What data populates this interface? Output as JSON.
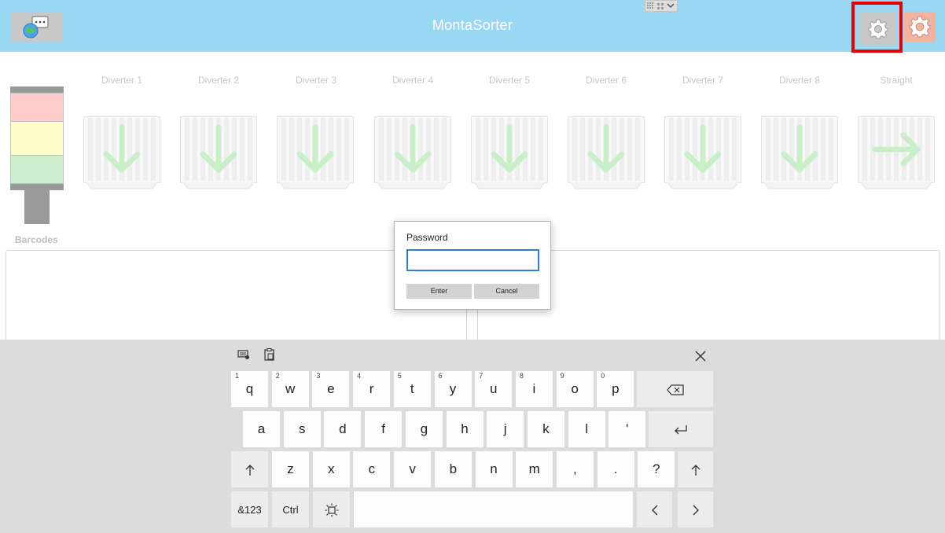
{
  "header": {
    "title": "MontaSorter",
    "language_icon": "language-chat-icon",
    "settings_icon": "gear-icon",
    "settings2_icon": "gear-icon"
  },
  "stacklight": {
    "colors": [
      "#ffcccc",
      "#ffffcc",
      "#cdeecd"
    ]
  },
  "diverters": [
    {
      "label": "Diverter 1",
      "direction": "down"
    },
    {
      "label": "Diverter 2",
      "direction": "down"
    },
    {
      "label": "Diverter 3",
      "direction": "down"
    },
    {
      "label": "Diverter 4",
      "direction": "down"
    },
    {
      "label": "Diverter 5",
      "direction": "down"
    },
    {
      "label": "Diverter 6",
      "direction": "down"
    },
    {
      "label": "Diverter 7",
      "direction": "down"
    },
    {
      "label": "Diverter 8",
      "direction": "down"
    },
    {
      "label": "Straight",
      "direction": "right"
    }
  ],
  "barcodes": {
    "label": "Barcodes"
  },
  "password_dialog": {
    "label": "Password",
    "value": "",
    "enter_label": "Enter",
    "cancel_label": "Cancel"
  },
  "keyboard": {
    "row1": [
      {
        "label": "q",
        "hint": "1"
      },
      {
        "label": "w",
        "hint": "2"
      },
      {
        "label": "e",
        "hint": "3"
      },
      {
        "label": "r",
        "hint": "4"
      },
      {
        "label": "t",
        "hint": "5"
      },
      {
        "label": "y",
        "hint": "6"
      },
      {
        "label": "u",
        "hint": "7"
      },
      {
        "label": "i",
        "hint": "8"
      },
      {
        "label": "o",
        "hint": "9"
      },
      {
        "label": "p",
        "hint": "0"
      }
    ],
    "row2": [
      "a",
      "s",
      "d",
      "f",
      "g",
      "h",
      "j",
      "k",
      "l",
      "'"
    ],
    "row3": [
      "z",
      "x",
      "c",
      "v",
      "b",
      "n",
      "m",
      ",",
      ".",
      "?"
    ],
    "numbers_label": "&123",
    "ctrl_label": "Ctrl"
  },
  "colors": {
    "header_bg": "#9ad7f3",
    "highlight": "#e60000",
    "arrow": "#c8efc8"
  }
}
